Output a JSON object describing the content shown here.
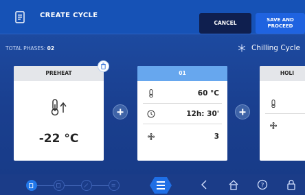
{
  "header": {
    "title": "CREATE CYCLE",
    "icon": "document-edit-icon",
    "cancel_label": "CANCEL",
    "save_label_line1": "SAVE AND",
    "save_label_line2": "PROCEED"
  },
  "info": {
    "total_label": "TOTAL PHASES:",
    "total_value": "02",
    "cycle_type": "Chilling Cycle",
    "cycle_icon": "snowflake-icon"
  },
  "phases": {
    "preheat": {
      "title": "PREHEAT",
      "temperature": "-22 °C",
      "icon": "thermometer-up-icon"
    },
    "phase01": {
      "title": "01",
      "temperature": "60 °C",
      "time": "12h: 30'",
      "fan": "3"
    },
    "hold": {
      "title": "HOLI"
    }
  },
  "footer": {
    "steps": [
      "cycle-step-icon",
      "probe-step-icon",
      "edit-step-icon",
      "list-step-icon"
    ],
    "nav": [
      "menu-icon",
      "back-icon",
      "home-icon",
      "help-icon",
      "lock-icon"
    ]
  },
  "colors": {
    "header": "#1652b6",
    "accent": "#1f63e0",
    "card_head_blue": "#67a7ee",
    "background": "#1a3f8f"
  }
}
